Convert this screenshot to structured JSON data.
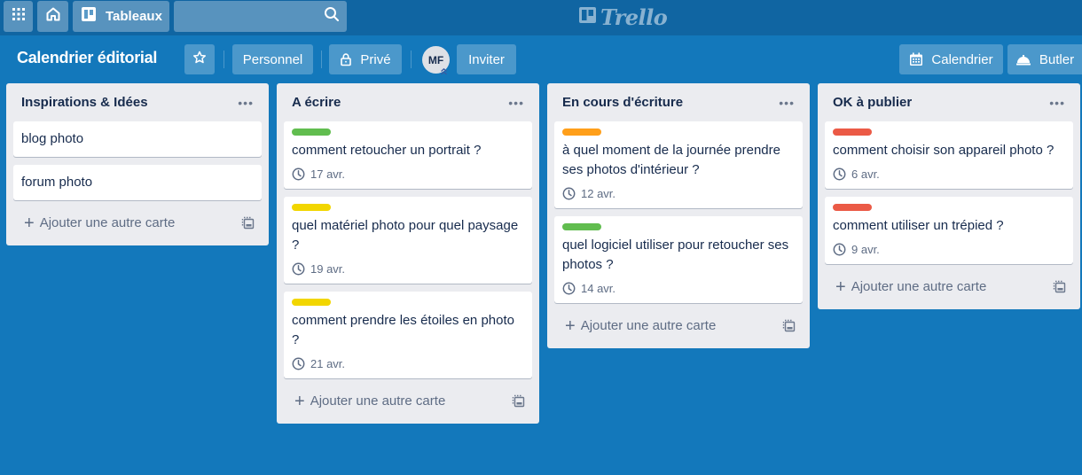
{
  "topbar": {
    "apps_icon": "apps-grid-icon",
    "home_icon": "home-icon",
    "boards_label": "Tableaux",
    "boards_icon": "board-icon",
    "search_value": "",
    "search_icon": "search-icon",
    "logo_text": "Trello"
  },
  "board": {
    "title": "Calendrier éditorial",
    "star_icon": "star-icon",
    "team_label": "Personnel",
    "visibility_label": "Privé",
    "visibility_icon": "lock-icon",
    "member_initials": "MF",
    "invite_label": "Inviter",
    "calendar_label": "Calendrier",
    "butler_label": "Butler"
  },
  "colors": {
    "background": "#1378bb",
    "topbar": "#1065a2",
    "list_bg": "#ebecf0",
    "label_green": "#61bd4f",
    "label_yellow": "#f2d600",
    "label_orange": "#ff9f1a",
    "label_red": "#eb5a46"
  },
  "lists": [
    {
      "title": "Inspirations & Idées",
      "cards": [
        {
          "title": "blog photo"
        },
        {
          "title": "forum photo"
        }
      ],
      "add_label": "Ajouter une autre carte"
    },
    {
      "title": "A écrire",
      "cards": [
        {
          "label": "green",
          "title": "comment retoucher un portrait ?",
          "due": "17 avr."
        },
        {
          "label": "yellow",
          "title": "quel matériel photo pour quel paysage ?",
          "due": "19 avr."
        },
        {
          "label": "yellow",
          "title": "comment prendre les étoiles en photo ?",
          "due": "21 avr."
        }
      ],
      "add_label": "Ajouter une autre carte"
    },
    {
      "title": "En cours d'écriture",
      "cards": [
        {
          "label": "orange",
          "title": "à quel moment de la journée prendre ses photos d'intérieur ?",
          "due": "12 avr."
        },
        {
          "label": "green",
          "title": "quel logiciel utiliser pour retoucher ses photos ?",
          "due": "14 avr."
        }
      ],
      "add_label": "Ajouter une autre carte"
    },
    {
      "title": "OK à publier",
      "cards": [
        {
          "label": "red",
          "title": "comment choisir son appareil photo ?",
          "due": "6 avr."
        },
        {
          "label": "red",
          "title": "comment utiliser un trépied ?",
          "due": "9 avr."
        }
      ],
      "add_label": "Ajouter une autre carte"
    }
  ]
}
